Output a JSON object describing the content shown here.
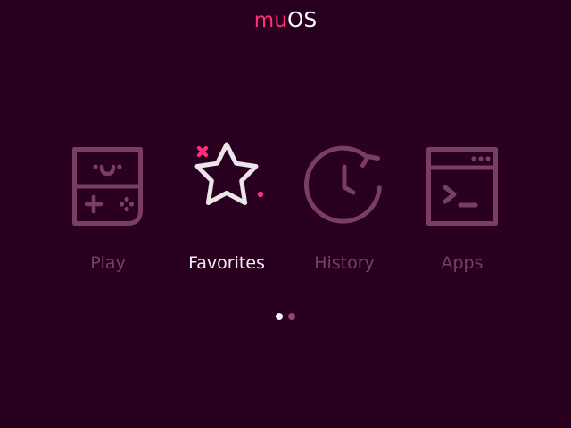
{
  "header": {
    "title_mu": "mu",
    "title_os": "OS"
  },
  "menu": {
    "items": [
      {
        "label": "Play",
        "icon": "gameboy-icon",
        "active": false
      },
      {
        "label": "Favorites",
        "icon": "star-icon",
        "active": true
      },
      {
        "label": "History",
        "icon": "history-clock-icon",
        "active": false
      },
      {
        "label": "Apps",
        "icon": "terminal-window-icon",
        "active": false
      }
    ]
  },
  "pagination": {
    "pages": 2,
    "current": 1
  },
  "colors": {
    "background": "#2a0020",
    "accent": "#ff2d7a",
    "inactive": "#7a3d64",
    "active": "#f3eef2"
  }
}
